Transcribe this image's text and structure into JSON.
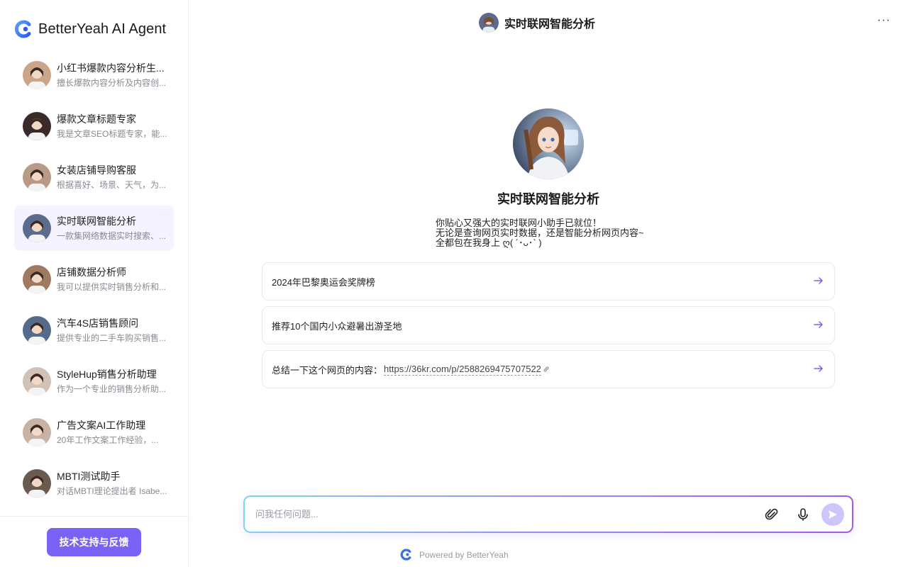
{
  "brand": {
    "name": "BetterYeah AI Agent"
  },
  "sidebar": {
    "agents": [
      {
        "name": "小红书爆款内容分析生...",
        "desc": "擅长爆款内容分析及内容创...",
        "avatar_color": "#caa58a",
        "active": false
      },
      {
        "name": "爆款文章标题专家",
        "desc": "我是文章SEO标题专家，能...",
        "avatar_color": "#3b2a2a",
        "active": false
      },
      {
        "name": "女装店铺导购客服",
        "desc": "根据喜好、场景、天气，为...",
        "avatar_color": "#b89a86",
        "active": false
      },
      {
        "name": "实时联网智能分析",
        "desc": "一款集网络数据实时搜索、...",
        "avatar_color": "#5b6c8e",
        "active": true
      },
      {
        "name": "店铺数据分析师",
        "desc": "我可以提供实时销售分析和...",
        "avatar_color": "#a07a60",
        "active": false
      },
      {
        "name": "汽车4S店销售顾问",
        "desc": "提供专业的二手车购买销售...",
        "avatar_color": "#556b8b",
        "active": false
      },
      {
        "name": "StyleHup销售分析助理",
        "desc": "作为一个专业的销售分析助...",
        "avatar_color": "#d2c2b5",
        "active": false
      },
      {
        "name": "广告文案AI工作助理",
        "desc": "20年工作文案工作经验，...",
        "avatar_color": "#c7b2a4",
        "active": false
      },
      {
        "name": "MBTI测试助手",
        "desc": "对话MBTI理论提出者 Isabe...",
        "avatar_color": "#6b5a4e",
        "active": false
      }
    ],
    "support_button": "技术支持与反馈"
  },
  "header": {
    "title": "实时联网智能分析",
    "more_label": "···"
  },
  "hero": {
    "name": "实时联网智能分析",
    "intro_lines": [
      "你贴心又强大的实时联网小助手已就位！",
      "无论是查询网页实时数据，还是智能分析网页内容~",
      "全都包在我身上 ღ( ´･ᴗ･` )"
    ]
  },
  "suggestions": [
    {
      "text": "2024年巴黎奥运会奖牌榜",
      "link": ""
    },
    {
      "text": "推荐10个国内小众避暑出游圣地",
      "link": ""
    },
    {
      "text": "总结一下这个网页的内容：",
      "link": "https://36kr.com/p/2588269475707522"
    }
  ],
  "composer": {
    "placeholder": "问我任何问题..."
  },
  "footer": {
    "powered_by": "Powered by BetterYeah"
  },
  "colors": {
    "accent": "#7b61f5",
    "active_bg": "#f5f3ff",
    "send_bg": "#cfc5fb"
  }
}
